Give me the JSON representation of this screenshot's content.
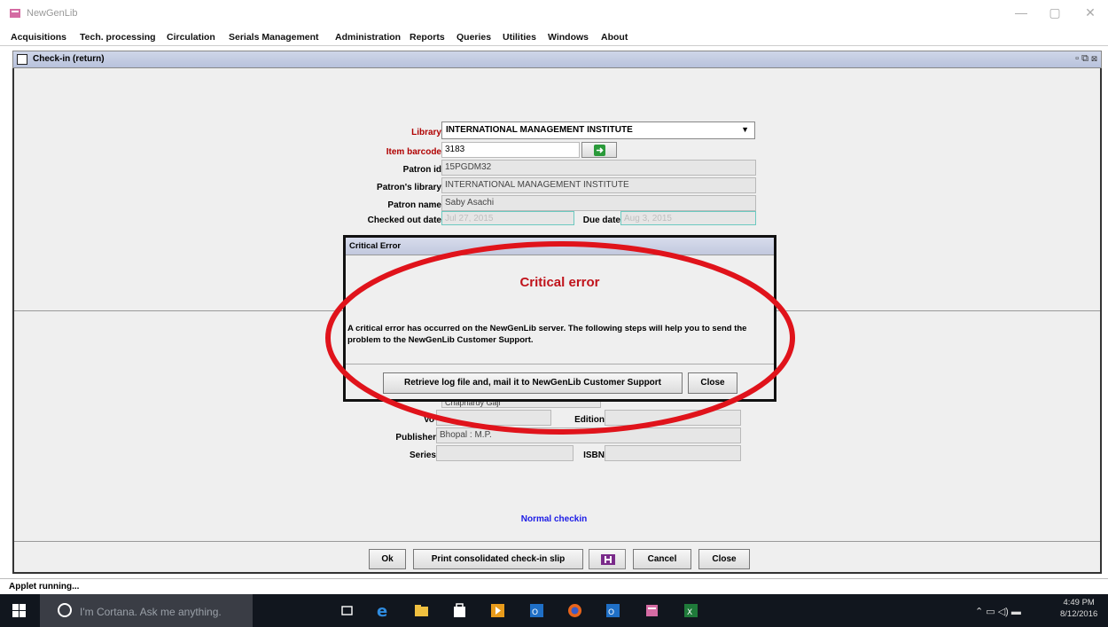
{
  "window": {
    "title": "NewGenLib",
    "min": "—",
    "max": "▢",
    "close": "✕"
  },
  "menu": [
    "Acquisitions",
    "Tech. processing",
    "Circulation",
    "Serials Management",
    "Administration",
    "Reports",
    "Queries",
    "Utilities",
    "Windows",
    "About"
  ],
  "inner_window": {
    "title": "Check-in (return)",
    "controls": "▫ ⧉ ⊠"
  },
  "form": {
    "library_label": "Library",
    "library_value": "INTERNATIONAL MANAGEMENT INSTITUTE",
    "barcode_label": "Item barcode",
    "barcode_value": "3183",
    "patron_id_label": "Patron id",
    "patron_id_value": "15PGDM32",
    "patron_library_label": "Patron's library",
    "patron_library_value": "INTERNATIONAL MANAGEMENT INSTITUTE",
    "patron_name_label": "Patron name",
    "patron_name_value": "Saby Asachi",
    "checked_out_label": "Checked out date",
    "checked_out_value": "Jul 27, 2015",
    "due_date_label": "Due date",
    "due_date_value": "Aug 3, 2015",
    "author_value": "Chaphardy Gaji",
    "volume_label": "Vo",
    "edition_label": "Edition",
    "publisher_label": "Publisher",
    "publisher_value": "Bhopal : M.P.",
    "series_label": "Series",
    "isbn_label": "ISBN",
    "normal_checkin": "Normal checkin"
  },
  "dialog": {
    "title": "Critical Error",
    "heading": "Critical error",
    "message": "A critical error has occurred on the NewGenLib server. The following steps will help you to send the problem to the NewGenLib Customer Support.",
    "retrieve_button": "Retrieve log file and, mail it to NewGenLib Customer Support",
    "close_button": "Close"
  },
  "bottom_buttons": {
    "ok": "Ok",
    "print": "Print consolidated check-in slip",
    "cancel": "Cancel",
    "close": "Close"
  },
  "status": "Applet running...",
  "taskbar": {
    "cortana": "I'm Cortana. Ask me anything.",
    "time": "4:49 PM",
    "date": "8/12/2016"
  },
  "colors": {
    "label_red": "#b00000",
    "dialog_heading": "#c0131b",
    "annotation_ellipse": "#e0131b",
    "normal_checkin": "#1a1ae6"
  },
  "icons": [
    "app-icon",
    "task-view-icon",
    "edge-icon",
    "file-explorer-icon",
    "store-icon",
    "media-icon",
    "outlook-icon",
    "firefox-icon",
    "outlook-icon",
    "app-icon",
    "excel-icon"
  ]
}
